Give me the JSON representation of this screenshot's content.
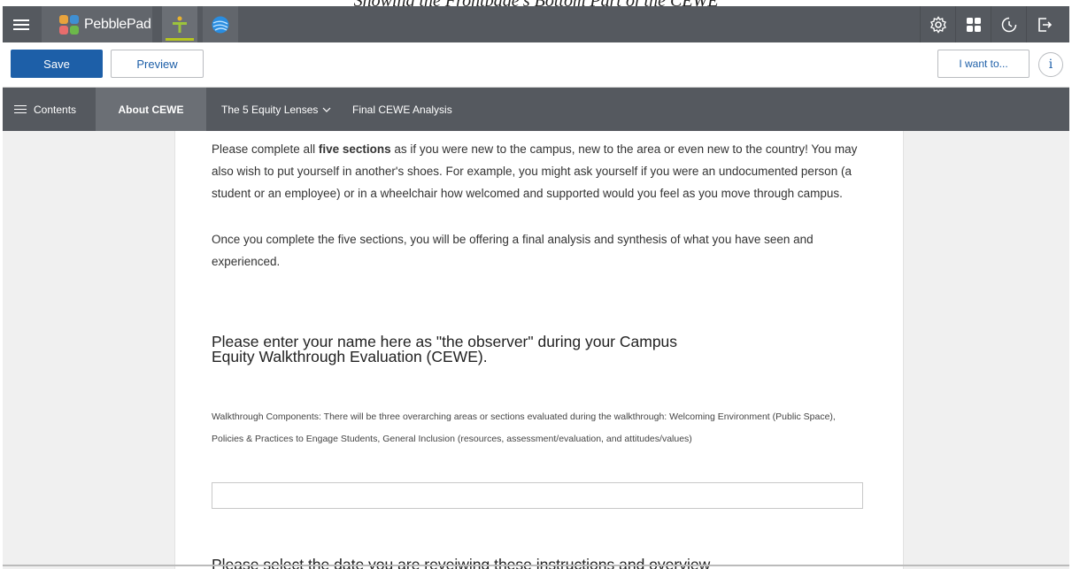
{
  "caption": "Showing the Frontpage's Bottom Part of the CEWE",
  "topbar": {
    "brand": "PebblePad",
    "icons": [
      "menu-icon",
      "pebblepad-logo-icon",
      "person-icon",
      "globe-icon",
      "settings-icon",
      "grid-icon",
      "history-icon",
      "logout-icon"
    ]
  },
  "toolbar": {
    "save_label": "Save",
    "preview_label": "Preview",
    "iwant_label": "I want to...",
    "info_label": "i"
  },
  "nav": {
    "contents_label": "Contents",
    "tabs": [
      {
        "label": "About CEWE",
        "active": true
      },
      {
        "label": "The 5 Equity Lenses",
        "dropdown": true
      },
      {
        "label": "Final CEWE Analysis"
      }
    ]
  },
  "content": {
    "p1_before": "Please complete all ",
    "p1_bold": "five sections",
    "p1_after": " as if you were new to the campus, new to the area or even new to the country! You may also wish to put yourself in another's shoes. For example, you might ask yourself if you were an undocumented person (a student or an employee) or in a wheelchair how welcomed and supported would you feel as you move through campus.",
    "p2": "Once you complete the five sections, you will be offering a final analysis and synthesis of what you have seen and experienced.",
    "name_heading": "Please enter your name here as \"the observer\" during your Campus Equity Walkthrough Evaluation (CEWE).",
    "components": "Walkthrough Components: There will be three overarching areas or sections evaluated during the walkthrough: Welcoming Environment (Public Space), Policies & Practices to Engage Students, General Inclusion (resources, assessment/evaluation, and attitudes/values)",
    "name_value": "",
    "date_heading": "Please select the date you are reveiwing these instructions and overview"
  },
  "colors": {
    "topbar": "#55595f",
    "accent_blue": "#1d5fa8",
    "active_underline": "#b5c520"
  }
}
